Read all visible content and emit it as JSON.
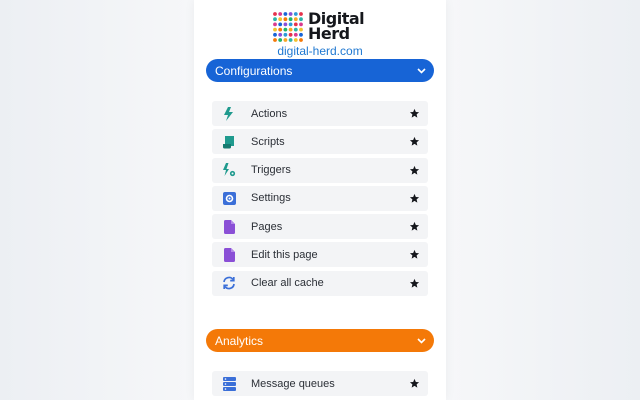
{
  "brand": {
    "logo_line1": "Digital",
    "logo_line2": "Herd",
    "site_link": "digital-herd.com"
  },
  "sections": {
    "configurations": {
      "title": "Configurations",
      "color": "#1764d6",
      "items": [
        {
          "label": "Actions",
          "icon": "lightning-icon"
        },
        {
          "label": "Scripts",
          "icon": "scroll-icon"
        },
        {
          "label": "Triggers",
          "icon": "trigger-gear-icon"
        },
        {
          "label": "Settings",
          "icon": "settings-gear-icon"
        },
        {
          "label": "Pages",
          "icon": "page-icon"
        },
        {
          "label": "Edit this page",
          "icon": "page-edit-icon"
        },
        {
          "label": "Clear all cache",
          "icon": "refresh-icon"
        }
      ]
    },
    "analytics": {
      "title": "Analytics",
      "color": "#f47908",
      "items": [
        {
          "label": "Message queues",
          "icon": "server-icon"
        }
      ]
    }
  },
  "colors": {
    "teal_icon": "#1f9a8e",
    "blue_icon": "#3b6fd8",
    "purple_icon": "#8a4fd6",
    "link": "#1f78d1"
  }
}
